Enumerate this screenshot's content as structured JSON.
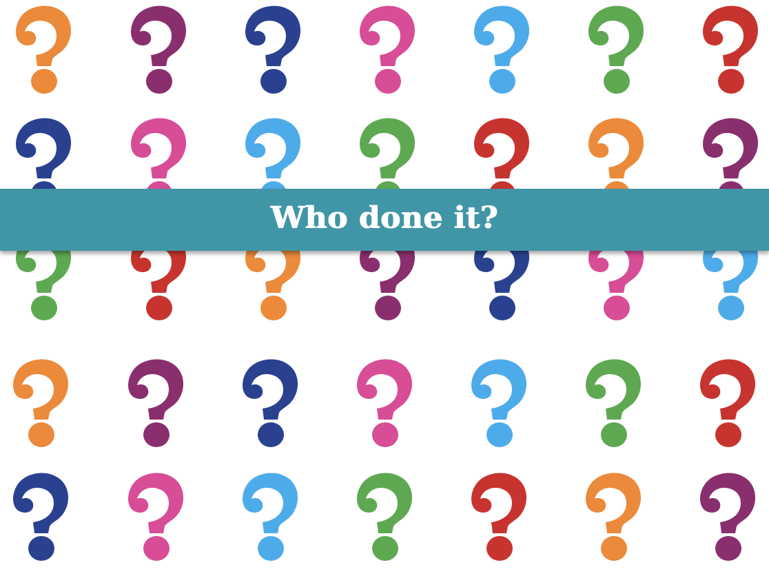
{
  "slide": {
    "title": "Who done it?",
    "banner_color": "#4096A6",
    "background_color": "#FFFFFF"
  },
  "palette": {
    "orange": "#EB8A3A",
    "purple": "#8A2F6E",
    "navy": "#2A4190",
    "pink": "#D74D96",
    "light-blue": "#4EABEA",
    "green": "#5FA852",
    "red": "#C7342F"
  },
  "question_mark_rows": [
    [
      "orange",
      "purple",
      "navy",
      "pink",
      "light-blue",
      "green",
      "red"
    ],
    [
      "navy",
      "pink",
      "light-blue",
      "green",
      "red",
      "orange",
      "purple"
    ],
    [
      "green",
      "red",
      "orange",
      "purple",
      "navy",
      "pink",
      "light-blue"
    ],
    [
      "orange",
      "purple",
      "navy",
      "pink",
      "light-blue",
      "green",
      "red"
    ],
    [
      "navy",
      "pink",
      "light-blue",
      "green",
      "red",
      "orange",
      "purple"
    ]
  ],
  "icon": "question-mark-icon"
}
